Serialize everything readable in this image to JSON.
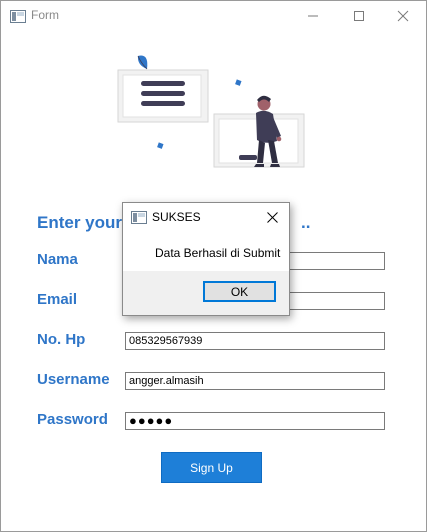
{
  "window": {
    "title": "Form",
    "icon": "form-app-icon"
  },
  "form": {
    "heading_start": "Enter your",
    "heading_end": "..",
    "fields": [
      {
        "label": "Nama",
        "value": ""
      },
      {
        "label": "Email",
        "value": ""
      },
      {
        "label": "No. Hp",
        "value": "085329567939"
      },
      {
        "label": "Username",
        "value": "angger.almasih"
      },
      {
        "label": "Password",
        "value": "●●●●●"
      }
    ],
    "submit_label": "Sign Up"
  },
  "dialog": {
    "title": "SUKSES",
    "message": "Data Berhasil di Submit",
    "ok_label": "OK"
  },
  "colors": {
    "accent": "#2f76c8",
    "button": "#1e7fd8",
    "illustration_primary": "#3f3d56",
    "illustration_accent": "#2f76c8"
  }
}
